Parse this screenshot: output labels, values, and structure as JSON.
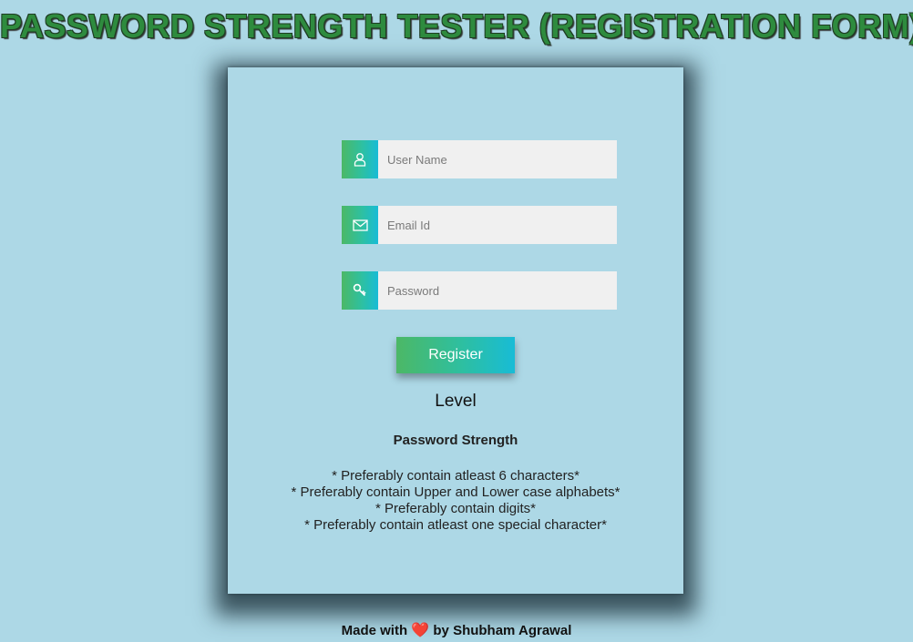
{
  "header": {
    "title": "PASSWORD STRENGTH TESTER (REGISTRATION FORM)"
  },
  "form": {
    "username": {
      "placeholder": "User Name",
      "value": "",
      "icon": "user-icon"
    },
    "email": {
      "placeholder": "Email Id",
      "value": "",
      "icon": "envelope-icon"
    },
    "password": {
      "placeholder": "Password",
      "value": "",
      "icon": "key-icon"
    },
    "register_label": "Register"
  },
  "strength": {
    "level_label": "Level",
    "title": "Password Strength",
    "rules": [
      "* Preferably contain atleast 6 characters*",
      "* Preferably contain Upper and Lower case alphabets*",
      "* Preferably contain digits*",
      "* Preferably contain atleast one special character*"
    ]
  },
  "footer": {
    "prefix": "Made with",
    "heart": "❤️",
    "suffix": "by Shubham Agrawal"
  },
  "colors": {
    "background": "#add8e6",
    "title_green": "#2e8b3e",
    "gradient_start": "#4cb866",
    "gradient_end": "#18bcd6",
    "input_bg": "#f0f0f0"
  }
}
